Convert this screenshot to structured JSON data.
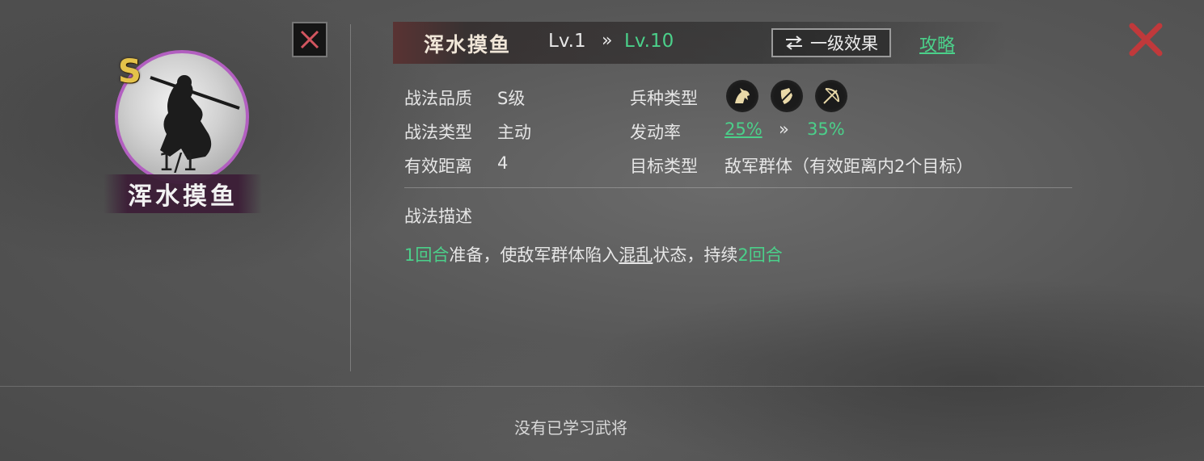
{
  "card": {
    "grade": "S",
    "count": "1/1",
    "skill_name": "浑水摸鱼"
  },
  "header": {
    "skill_name": "浑水摸鱼",
    "level_from": "Lv.1",
    "level_arrow": "»",
    "level_to": "Lv.10",
    "effect_button": "一级效果",
    "guide_link": "攻略"
  },
  "info": {
    "quality_label": "战法品质",
    "quality_value": "S级",
    "type_label": "战法类型",
    "type_value": "主动",
    "range_label": "有效距离",
    "range_value": "4",
    "troop_label": "兵种类型",
    "troop_icons": [
      "cavalry-icon",
      "shield-icon",
      "archer-icon"
    ],
    "rate_label": "发动率",
    "rate_from": "25%",
    "rate_arrow": "»",
    "rate_to": "35%",
    "target_label": "目标类型",
    "target_value": "敌军群体（有效距离内2个目标）"
  },
  "description": {
    "title": "战法描述",
    "part1": "1回合",
    "part2": "准备，使敌军群体陷入",
    "part3": "混乱",
    "part4": "状态，持续",
    "part5": "2回合"
  },
  "footer": {
    "text": "没有已学习武将"
  },
  "colors": {
    "accent_green": "#4bd08a",
    "grade_gold": "#e4c24a",
    "portrait_border": "#b25fc0",
    "close_red": "#c0393b"
  }
}
